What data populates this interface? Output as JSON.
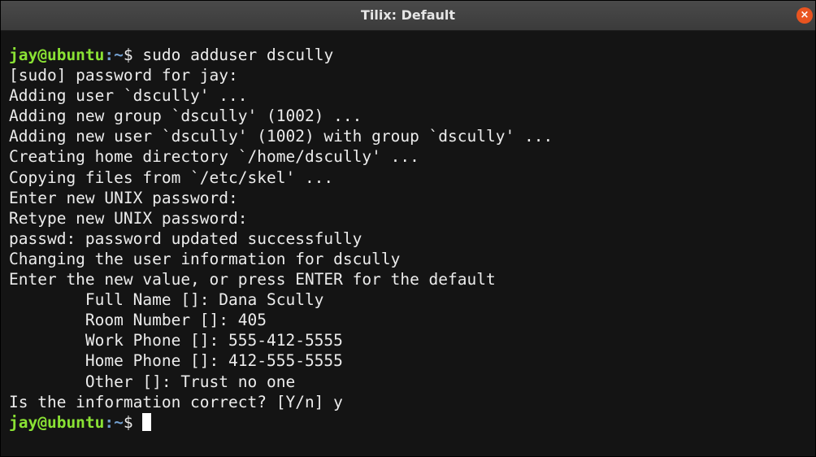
{
  "window": {
    "title": "Tilix: Default",
    "close_glyph": "×",
    "colors": {
      "titlebar": "#3f3f3f",
      "terminal_bg": "#141414",
      "text": "#ececec",
      "prompt_user": "#8ae234",
      "close_button": "#e95420"
    }
  },
  "terminal": {
    "prompt1": {
      "user_host": "jay@ubuntu",
      "separator": ":",
      "path": "~",
      "symbol": "$ ",
      "command": "sudo adduser dscully"
    },
    "output": [
      "[sudo] password for jay:",
      "Adding user `dscully' ...",
      "Adding new group `dscully' (1002) ...",
      "Adding new user `dscully' (1002) with group `dscully' ...",
      "Creating home directory `/home/dscully' ...",
      "Copying files from `/etc/skel' ...",
      "Enter new UNIX password:",
      "Retype new UNIX password:",
      "passwd: password updated successfully",
      "Changing the user information for dscully",
      "Enter the new value, or press ENTER for the default",
      "        Full Name []: Dana Scully",
      "        Room Number []: 405",
      "        Work Phone []: 555-412-5555",
      "        Home Phone []: 412-555-5555",
      "        Other []: Trust no one",
      "Is the information correct? [Y/n] y"
    ],
    "prompt2": {
      "user_host": "jay@ubuntu",
      "separator": ":",
      "path": "~",
      "symbol": "$ "
    }
  }
}
